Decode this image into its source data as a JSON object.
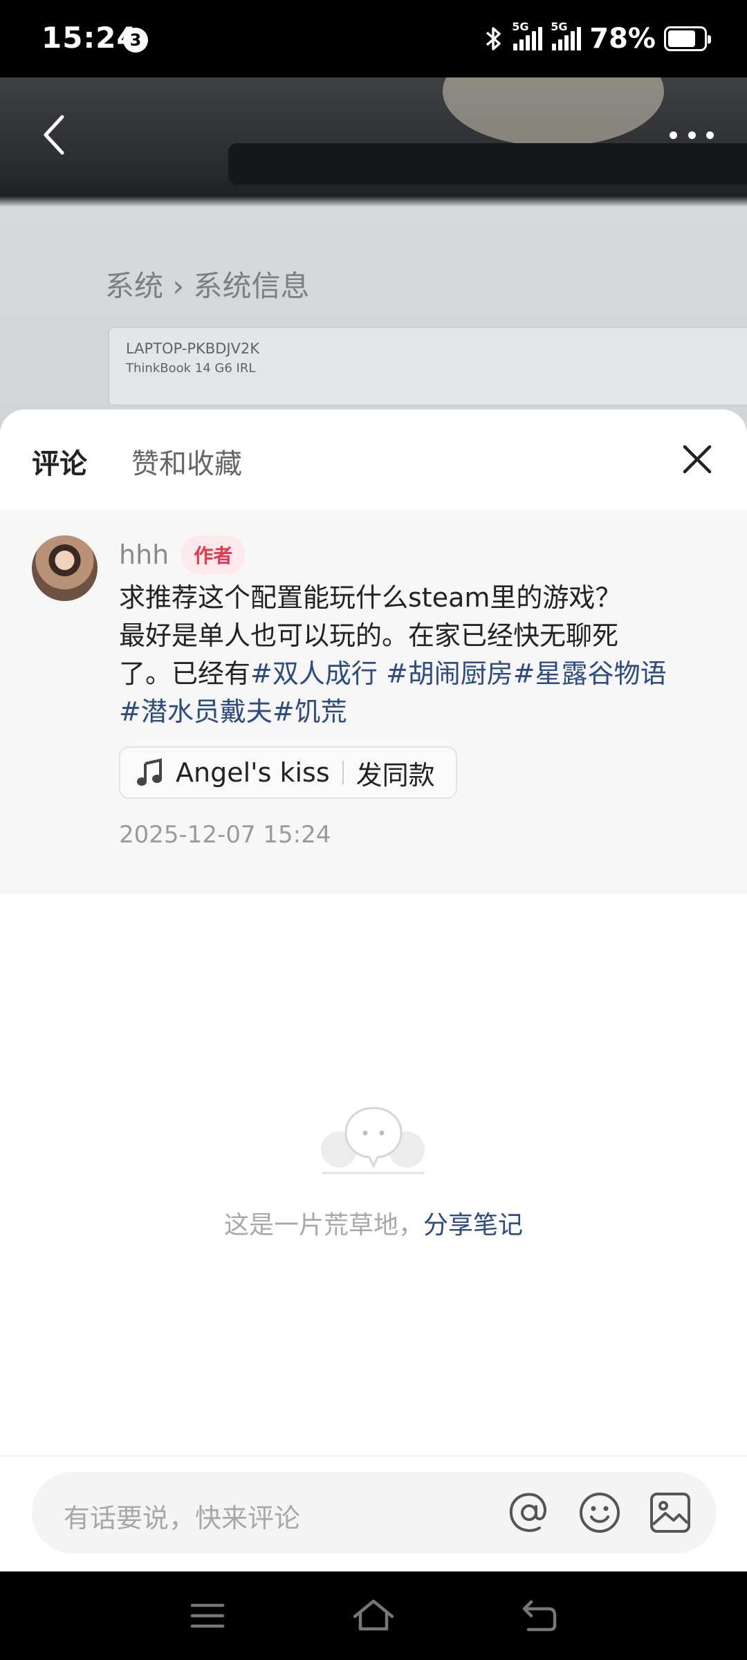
{
  "status_bar": {
    "time": "15:24",
    "notification_count": "3",
    "network_1": "5G",
    "network_2": "5G",
    "battery_percent": "78%",
    "battery_level": 0.78
  },
  "background_photo": {
    "breadcrumb": "系统 › 系统信息",
    "device_name": "LAPTOP-PKBDJV2K",
    "device_model": "ThinkBook 14 G6 IRL"
  },
  "sheet": {
    "tabs": [
      {
        "label": "评论",
        "active": true
      },
      {
        "label": "赞和收藏",
        "active": false
      }
    ]
  },
  "post": {
    "author": "hhh",
    "author_badge": "作者",
    "text_line1": "求推荐这个配置能玩什么steam里的游戏？",
    "text_line2": "最好是单人也可以玩的。在家已经快无聊死",
    "text_line3_prefix": "了。已经有",
    "tags": [
      "#双人成行",
      "#胡闹厨房",
      "#星露谷物语",
      "#潜水员戴夫",
      "#饥荒"
    ],
    "music_title": "Angel's kiss",
    "music_action": "发同款",
    "date": "2025-12-07 15:24"
  },
  "empty_state": {
    "text": "这是一片荒草地，",
    "link": "分享笔记"
  },
  "comment_input": {
    "placeholder": "有话要说，快来评论"
  },
  "icons": {
    "back": "chevron-left-icon",
    "more": "more-dots-icon",
    "close": "close-icon",
    "music": "music-note-icon",
    "mention": "at-sign-icon",
    "emoji": "smiley-icon",
    "image": "image-icon"
  },
  "colors": {
    "tag_link": "#2b4b82",
    "author_badge": "#e03a4f",
    "post_background": "#f7f7f7"
  }
}
